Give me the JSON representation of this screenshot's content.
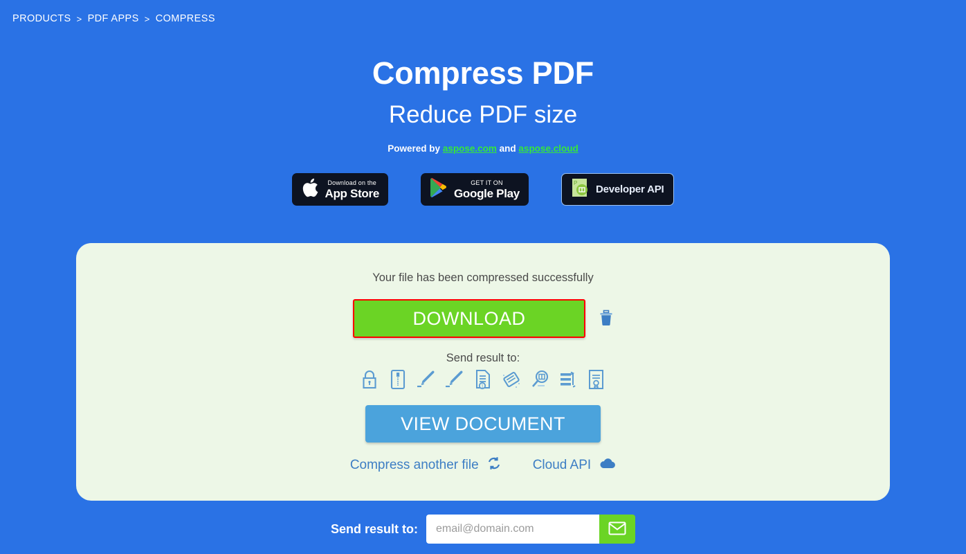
{
  "breadcrumb": {
    "items": [
      {
        "label": "PRODUCTS"
      },
      {
        "label": "PDF APPS"
      },
      {
        "label": "COMPRESS"
      }
    ],
    "separator": ">"
  },
  "hero": {
    "title": "Compress PDF",
    "subtitle": "Reduce PDF size",
    "powered_prefix": "Powered by",
    "powered_link1": "aspose.com",
    "powered_conjunction": "and",
    "powered_link2": "aspose.cloud"
  },
  "badges": [
    {
      "name": "app-store",
      "small": "Download on the",
      "big": "App Store",
      "icon": "apple-icon"
    },
    {
      "name": "google-play",
      "small": "GET IT ON",
      "big": "Google Play",
      "icon": "google-play-icon"
    },
    {
      "name": "developer-api",
      "label": "Developer API",
      "icon": "aspose-logo-icon"
    }
  ],
  "card": {
    "status_message": "Your file has been compressed successfully",
    "download_label": "DOWNLOAD",
    "delete_icon": "trash-icon",
    "send_result_label": "Send result to:",
    "view_document_label": "VIEW DOCUMENT",
    "tools": [
      {
        "name": "protect-pdf",
        "icon": "lock-icon"
      },
      {
        "name": "compress-pdf",
        "icon": "zipper-document-icon"
      },
      {
        "name": "sign-pdf",
        "icon": "pen-icon"
      },
      {
        "name": "esign-pdf",
        "icon": "pen-icon"
      },
      {
        "name": "number-pages",
        "icon": "numbered-document-icon"
      },
      {
        "name": "erase-pdf",
        "icon": "eraser-icon"
      },
      {
        "name": "search-pdf",
        "icon": "magnifier-document-icon"
      },
      {
        "name": "rotate-pdf",
        "icon": "rotate-lines-icon"
      },
      {
        "name": "certify-pdf",
        "icon": "certificate-icon"
      }
    ],
    "links": [
      {
        "name": "compress-another-file",
        "label": "Compress another file",
        "icon": "refresh-icon"
      },
      {
        "name": "cloud-api",
        "label": "Cloud API",
        "icon": "cloud-icon"
      }
    ]
  },
  "footer": {
    "label": "Send result to:",
    "email_placeholder": "email@domain.com",
    "email_value": "",
    "send_icon": "envelope-icon"
  },
  "colors": {
    "page_background": "#2a72e5",
    "card_background": "#edf7e7",
    "accent_green": "#6bd425",
    "accent_blue": "#4ba3dc",
    "link_green": "#35e83a",
    "highlight_red": "#ff0000",
    "icon_blue": "#5b9bd1"
  }
}
